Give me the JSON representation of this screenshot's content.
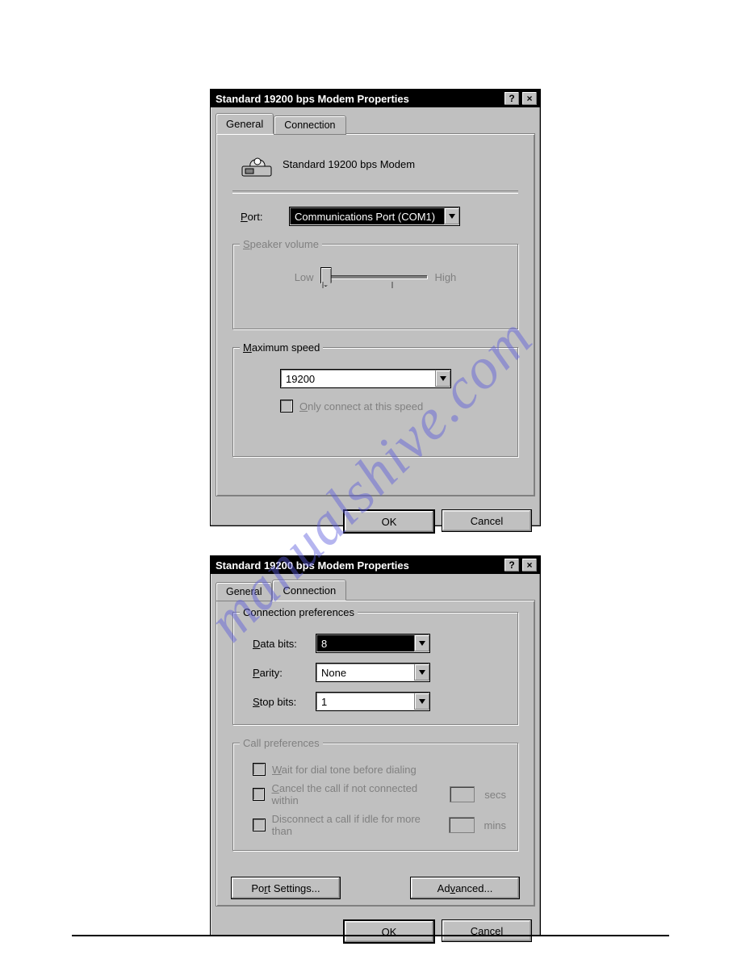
{
  "watermark": "manualshive.com",
  "dialog1": {
    "title": "Standard 19200 bps Modem Properties",
    "help_glyph": "?",
    "close_glyph": "×",
    "tabs": {
      "general": "General",
      "connection": "Connection"
    },
    "header_text": "Standard 19200 bps Modem",
    "port_label_pre": "P",
    "port_label_post": "ort:",
    "port_value": "Communications Port (COM1)",
    "speaker": {
      "legend_pre": "S",
      "legend_post": "peaker volume",
      "low": "Low",
      "high": "High"
    },
    "maxspeed": {
      "legend_pre": "M",
      "legend_post": "aximum speed",
      "value": "19200",
      "only_connect_pre": "O",
      "only_connect_post": "nly connect at this speed"
    },
    "ok": "OK",
    "cancel": "Cancel"
  },
  "dialog2": {
    "title": "Standard 19200 bps Modem Properties",
    "help_glyph": "?",
    "close_glyph": "×",
    "tabs": {
      "general": "General",
      "connection": "Connection"
    },
    "conn_pref": {
      "legend": "Connection preferences",
      "data_bits_pre": "D",
      "data_bits_post": "ata bits:",
      "data_bits_value": "8",
      "parity_pre": "P",
      "parity_post": "arity:",
      "parity_value": "None",
      "stop_bits_pre": "S",
      "stop_bits_post": "top bits:",
      "stop_bits_value": "1"
    },
    "call_pref": {
      "legend": "Call preferences",
      "wait_pre": "W",
      "wait_post": "ait for dial tone before dialing",
      "cancel_pre": "C",
      "cancel_post": "ancel the call if not connected within",
      "cancel_unit": "secs",
      "disconnect": "Disconnect a call if idle for more than",
      "disconnect_unit": "mins"
    },
    "port_settings_pre": "Po",
    "port_settings_u": "r",
    "port_settings_post": "t Settings...",
    "advanced_pre": "Ad",
    "advanced_u": "v",
    "advanced_post": "anced...",
    "ok": "OK",
    "cancel": "Cancel"
  }
}
